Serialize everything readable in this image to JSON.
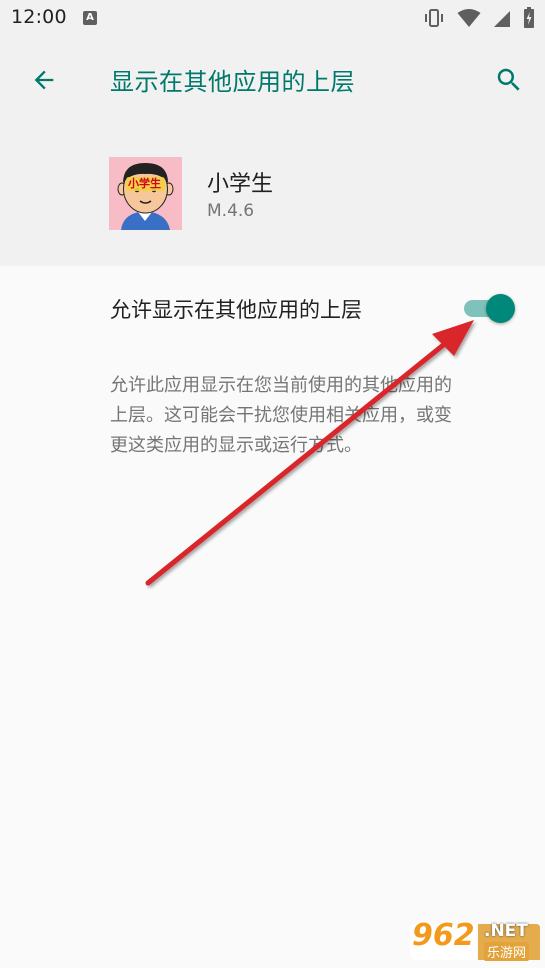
{
  "status_bar": {
    "time": "12:00",
    "notification_icon_letter": "A",
    "icons": [
      "vibrate-icon",
      "wifi-icon",
      "signal-icon",
      "battery-icon"
    ]
  },
  "app_bar": {
    "title": "显示在其他应用的上层",
    "back_icon": "arrow-back-icon",
    "search_icon": "search-icon",
    "accent_color": "#00796b"
  },
  "app_info": {
    "name": "小学生",
    "version": "M.4.6",
    "icon_text": "小学生"
  },
  "setting": {
    "label": "允许显示在其他应用的上层",
    "enabled": true,
    "toggle_color": "#00897b",
    "description": "允许此应用显示在您当前使用的其他应用的\n上层。这可能会干扰您使用相关应用，或变\n更这类应用的显示或运行方式。"
  },
  "annotation": {
    "type": "red-arrow",
    "color": "#d9262c"
  },
  "watermark": {
    "number": "962",
    "suffix": ".NET",
    "site": "乐游网"
  }
}
